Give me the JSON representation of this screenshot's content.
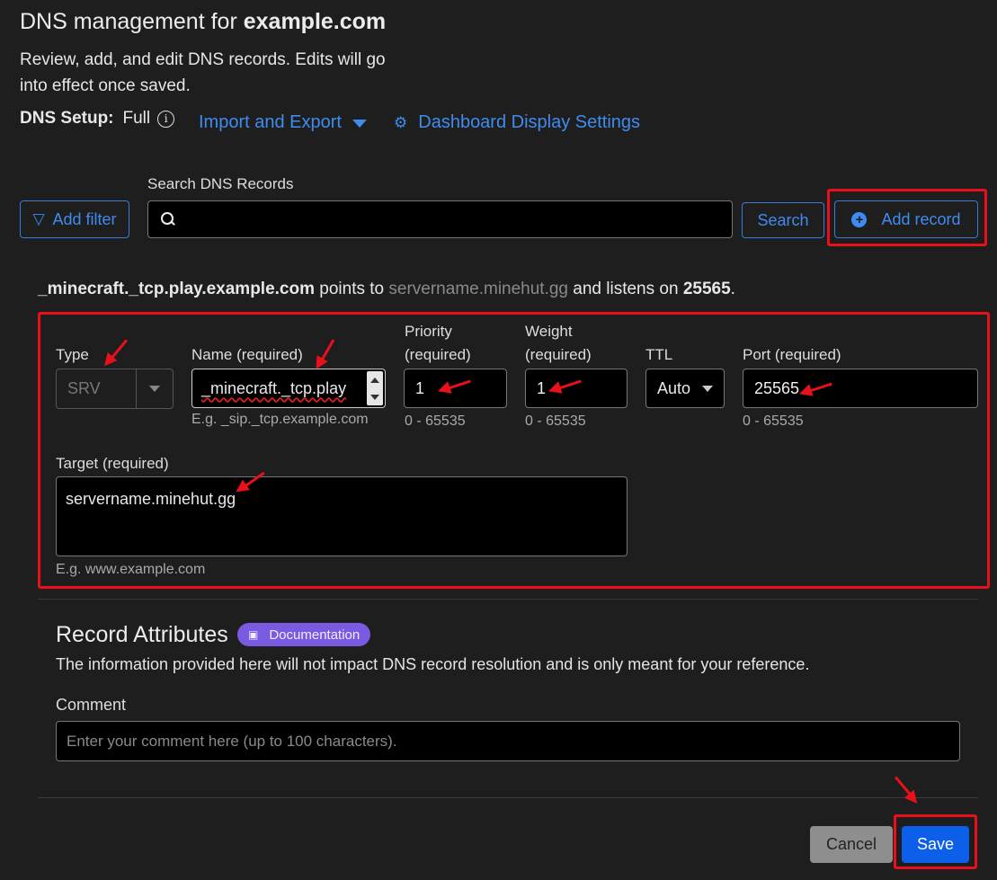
{
  "header": {
    "title_prefix": "DNS management for",
    "domain": "example.com",
    "description": "Review, add, and edit DNS records. Edits will go into effect once saved.",
    "setup_label": "DNS Setup:",
    "setup_value": "Full",
    "import_export": "Import and Export",
    "dashboard_settings": "Dashboard Display Settings"
  },
  "toolbar": {
    "add_filter": "Add filter",
    "search_label": "Search DNS Records",
    "search_value": "",
    "search_button": "Search",
    "add_record": "Add record"
  },
  "summary": {
    "name": "_minecraft._tcp.play.example.com",
    "points_to": "points to",
    "target": "servername.minehut.gg",
    "listens_on": "and listens on",
    "port": "25565",
    "end": "."
  },
  "form": {
    "type_label": "Type",
    "type_value": "SRV",
    "name_label": "Name (required)",
    "name_value": "_minecraft._tcp.play",
    "name_hint": "E.g. _sip._tcp.example.com",
    "priority_label_1": "Priority",
    "priority_label_2": "(required)",
    "priority_value": "1",
    "priority_hint": "0 - 65535",
    "weight_label_1": "Weight",
    "weight_label_2": "(required)",
    "weight_value": "1",
    "weight_hint": "0 - 65535",
    "ttl_label": "TTL",
    "ttl_value": "Auto",
    "port_label": "Port (required)",
    "port_value": "25565",
    "port_hint": "0 - 65535",
    "target_label": "Target (required)",
    "target_value": "servername.minehut.gg",
    "target_hint": "E.g. www.example.com"
  },
  "attributes": {
    "title": "Record Attributes",
    "doc_badge": "Documentation",
    "description": "The information provided here will not impact DNS record resolution and is only meant for your reference.",
    "comment_label": "Comment",
    "comment_placeholder": "Enter your comment here (up to 100 characters)."
  },
  "actions": {
    "cancel": "Cancel",
    "save": "Save"
  },
  "icons": [
    "info-icon",
    "caret-down-icon",
    "gear-icon",
    "filter-icon",
    "search-icon",
    "plus-circle-icon",
    "book-icon"
  ],
  "colors": {
    "background": "#1e1e1e",
    "link": "#3f8cf0",
    "primary_button": "#0b5fe8",
    "annotation_red": "#e8111b",
    "badge": "#7a5ae0"
  }
}
